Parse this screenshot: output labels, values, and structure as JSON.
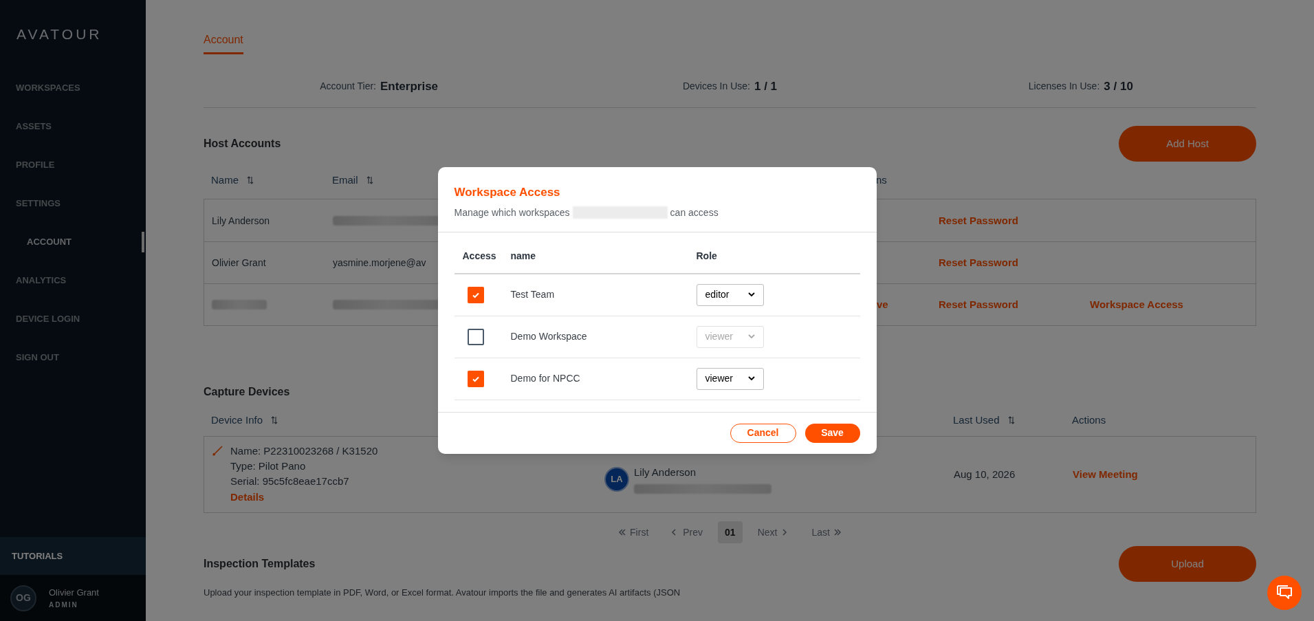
{
  "sidebar": {
    "logo": "AVATOUR",
    "items": [
      {
        "label": "WORKSPACES",
        "selected": false
      },
      {
        "label": "ASSETS",
        "selected": false
      },
      {
        "label": "PROFILE",
        "selected": false
      },
      {
        "label": "SETTINGS",
        "selected": false,
        "children": [
          {
            "label": "ACCOUNT",
            "selected": true
          }
        ]
      },
      {
        "label": "ANALYTICS",
        "selected": false
      },
      {
        "label": "DEVICE LOGIN",
        "selected": false
      },
      {
        "label": "SIGN OUT",
        "selected": false
      }
    ],
    "footer_item": {
      "label": "TUTORIALS"
    },
    "user": {
      "initials": "OG",
      "name": "Olivier Grant",
      "role": "ADMIN"
    }
  },
  "tabs": [
    {
      "label": "Account",
      "selected": true
    }
  ],
  "stats": [
    {
      "label": "Account Tier:",
      "value": "Enterprise"
    },
    {
      "label": "Devices In Use:",
      "value": "1 / 1"
    },
    {
      "label": "Licenses In Use:",
      "value": "3 / 10"
    }
  ],
  "host_accounts": {
    "title": "Host Accounts",
    "button": "Add Host",
    "columns": [
      {
        "label": "Name",
        "sortable": true
      },
      {
        "label": "Email",
        "sortable": true
      },
      {
        "label": "ns",
        "sortable": false
      }
    ],
    "rows": [
      {
        "cells": [
          {
            "kind": "text",
            "text": "Lily Anderson"
          },
          {
            "kind": "redacted"
          },
          {
            "kind": "none"
          },
          {
            "kind": "link",
            "text": "Reset Password"
          },
          {
            "kind": "none"
          }
        ]
      },
      {
        "cells": [
          {
            "kind": "text",
            "text": "Olivier Grant"
          },
          {
            "kind": "text",
            "text": "yasmine.morjene@av"
          },
          {
            "kind": "none"
          },
          {
            "kind": "link",
            "text": "Reset Password"
          },
          {
            "kind": "none"
          }
        ]
      },
      {
        "cells": [
          {
            "kind": "redacted"
          },
          {
            "kind": "redacted"
          },
          {
            "kind": "link",
            "text": "ve"
          },
          {
            "kind": "link",
            "text": "Reset Password"
          },
          {
            "kind": "link",
            "text": "Workspace Access"
          }
        ]
      }
    ]
  },
  "capture_devices": {
    "title": "Capture Devices",
    "columns": [
      {
        "label": "Device Info",
        "sortable": true
      },
      {
        "label": "Last Used",
        "sortable": true
      },
      {
        "label": "Actions",
        "sortable": false
      }
    ],
    "rows": [
      {
        "device_lines": [
          "Name: P22310023268 / K31520",
          "Type: Pilot Pano",
          "Serial: 95c5fc8eae17ccb7"
        ],
        "details": "Details",
        "user": {
          "initials": "LA",
          "name": "Lily Anderson"
        },
        "last_used": "Aug 10, 2026",
        "action": "View Meeting"
      }
    ],
    "pagination": [
      {
        "kind": "first",
        "label": "First",
        "selected": false
      },
      {
        "kind": "prev",
        "label": "Prev",
        "selected": false
      },
      {
        "kind": "page",
        "label": "01",
        "selected": true
      },
      {
        "kind": "next",
        "label": "Next",
        "selected": false
      },
      {
        "kind": "last",
        "label": "Last",
        "selected": false
      }
    ]
  },
  "inspection_templates": {
    "title": "Inspection Templates",
    "button": "Upload",
    "description": "Upload your inspection template in PDF, Word, or Excel format. Avatour imports the file and generates AI artifacts (JSON"
  },
  "modal": {
    "title": "Workspace Access",
    "subtitle_before": "Manage which workspaces",
    "subtitle_after": "can access",
    "columns": [
      "Access",
      "name",
      "Role"
    ],
    "rows": [
      {
        "name": "Test Team",
        "checked": true,
        "role": "editor",
        "disabled": false
      },
      {
        "name": "Demo Workspace",
        "checked": false,
        "role": "viewer",
        "disabled": true
      },
      {
        "name": "Demo for NPCC",
        "checked": true,
        "role": "viewer",
        "disabled": false
      }
    ],
    "cancel": "Cancel",
    "save": "Save"
  }
}
